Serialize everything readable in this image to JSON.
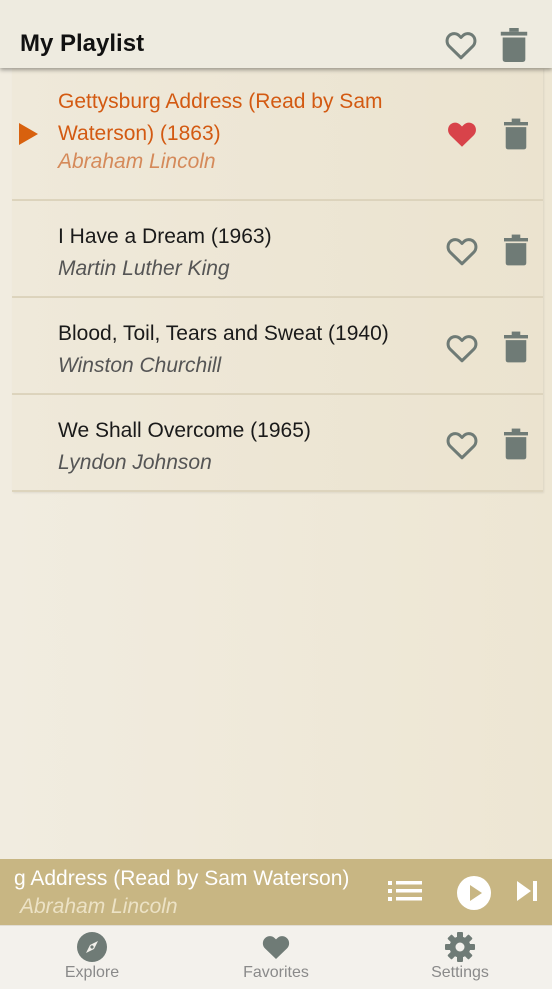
{
  "header": {
    "title": "My Playlist"
  },
  "tracks": [
    {
      "title": "Gettysburg Address (Read by Sam Waterson) (1863)",
      "artist": "Abraham Lincoln",
      "favorite": true,
      "playing": true
    },
    {
      "title": "I Have a Dream (1963)",
      "artist": "Martin Luther King",
      "favorite": false,
      "playing": false
    },
    {
      "title": "Blood, Toil, Tears and Sweat (1940)",
      "artist": "Winston Churchill",
      "favorite": false,
      "playing": false
    },
    {
      "title": "We Shall Overcome (1965)",
      "artist": "Lyndon Johnson",
      "favorite": false,
      "playing": false
    }
  ],
  "now_playing": {
    "title_visible": "g Address (Read by Sam Waterson)",
    "artist": "Abraham Lincoln"
  },
  "nav": {
    "explore": "Explore",
    "favorites": "Favorites",
    "settings": "Settings"
  },
  "icons": {
    "header_favorite": "heart-outline-icon",
    "header_delete": "trash-icon",
    "row_favorite": "heart-outline-icon",
    "row_favorite_active": "heart-filled-icon",
    "row_delete": "trash-icon",
    "playing_indicator": "play-triangle-icon",
    "queue": "list-icon",
    "play": "play-circle-icon",
    "next": "skip-next-icon",
    "explore": "compass-icon",
    "favorites": "heart-icon",
    "settings": "gear-icon"
  },
  "colors": {
    "accent": "#d35a12",
    "favorite_active": "#d8434a",
    "icon_gray": "#6f7b76",
    "player_bar": "#c8b683"
  }
}
